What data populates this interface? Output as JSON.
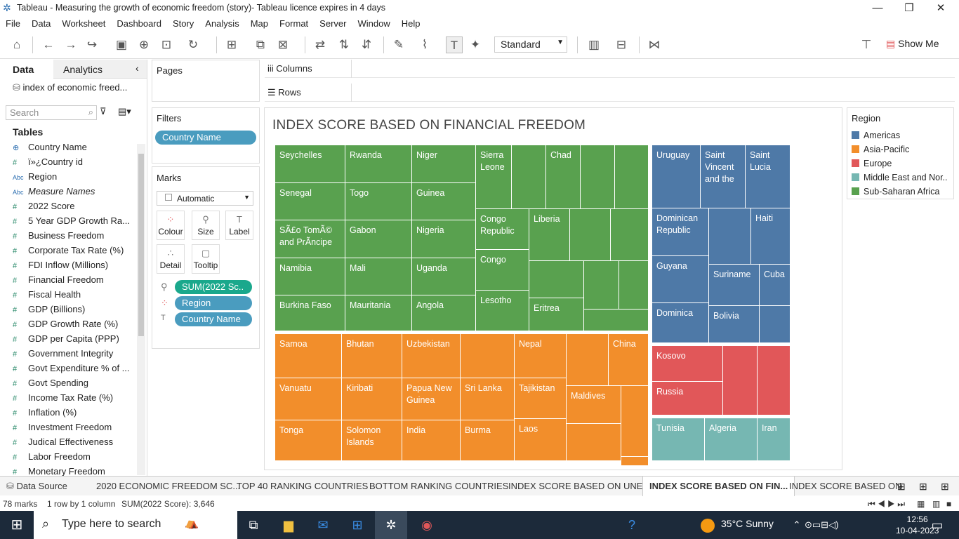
{
  "window": {
    "title": "Tableau - Measuring the growth of economic freedom (story)- Tableau licence expires in 4 days"
  },
  "menu": [
    "File",
    "Data",
    "Worksheet",
    "Dashboard",
    "Story",
    "Analysis",
    "Map",
    "Format",
    "Server",
    "Window",
    "Help"
  ],
  "toolbar": {
    "view_size": "Standard",
    "show_me": "Show Me"
  },
  "left_panel": {
    "tab_data": "Data",
    "tab_analytics": "Analytics",
    "data_source": "index of economic freed...",
    "search_placeholder": "Search",
    "tables_heading": "Tables",
    "fields": [
      {
        "type": "geo",
        "name": "Country Name"
      },
      {
        "type": "num",
        "name": "ï»¿Country id"
      },
      {
        "type": "abc",
        "name": "Region"
      },
      {
        "type": "abc",
        "name": "Measure Names"
      },
      {
        "type": "num",
        "name": "2022 Score"
      },
      {
        "type": "num",
        "name": "5 Year GDP Growth Ra..."
      },
      {
        "type": "num",
        "name": "Business Freedom"
      },
      {
        "type": "num",
        "name": "Corporate Tax Rate (%)"
      },
      {
        "type": "num",
        "name": "FDI Inflow (Millions)"
      },
      {
        "type": "num",
        "name": "Financial Freedom"
      },
      {
        "type": "num",
        "name": "Fiscal Health"
      },
      {
        "type": "num",
        "name": "GDP (Billions)"
      },
      {
        "type": "num",
        "name": "GDP Growth Rate (%)"
      },
      {
        "type": "num",
        "name": "GDP per Capita (PPP)"
      },
      {
        "type": "num",
        "name": "Government Integrity"
      },
      {
        "type": "num",
        "name": "Govt Expenditure % of ..."
      },
      {
        "type": "num",
        "name": "Govt Spending"
      },
      {
        "type": "num",
        "name": "Income Tax Rate (%)"
      },
      {
        "type": "num",
        "name": "Inflation (%)"
      },
      {
        "type": "num",
        "name": "Investment Freedom"
      },
      {
        "type": "num",
        "name": "Judical Effectiveness"
      },
      {
        "type": "num",
        "name": "Labor Freedom"
      },
      {
        "type": "num",
        "name": "Monetary Freedom"
      }
    ]
  },
  "cards": {
    "pages": "Pages",
    "filters": "Filters",
    "filter_pill": "Country Name",
    "marks": "Marks",
    "mark_type": "Automatic",
    "mark_buttons": [
      "Colour",
      "Size",
      "Label",
      "Detail",
      "Tooltip"
    ],
    "mark_pills": [
      "SUM(2022 Sc..",
      "Region",
      "Country Name"
    ]
  },
  "shelves": {
    "columns": "Columns",
    "rows": "Rows"
  },
  "view": {
    "title": "INDEX SCORE BASED ON FINANCIAL FREEDOM"
  },
  "legend": {
    "title": "Region",
    "items": [
      {
        "label": "Americas",
        "color": "#4e79a7"
      },
      {
        "label": "Asia-Pacific",
        "color": "#f28e2b"
      },
      {
        "label": "Europe",
        "color": "#e15759"
      },
      {
        "label": "Middle East and Nor..",
        "color": "#76b7b2"
      },
      {
        "label": "Sub-Saharan Africa",
        "color": "#59a14f"
      }
    ]
  },
  "treemap_labels": {
    "seychelles": "Seychelles",
    "rwanda": "Rwanda",
    "niger": "Niger",
    "sierra": "Sierra Leone",
    "chad": "Chad",
    "senegal": "Senegal",
    "togo": "Togo",
    "guinea": "Guinea",
    "congo_rep": "Congo Republic",
    "liberia": "Liberia",
    "sao": "SÃ£o TomÃ© and PrÃ­ncipe",
    "gabon": "Gabon",
    "nigeria": "Nigeria",
    "congo": "Congo",
    "namibia": "Namibia",
    "mali": "Mali",
    "uganda": "Uganda",
    "lesotho": "Lesotho",
    "eritrea": "Eritrea",
    "burkina": "Burkina Faso",
    "mauritania": "Mauritania",
    "angola": "Angola",
    "uruguay": "Uruguay",
    "svg": "Saint Vincent and the",
    "lucia": "Saint Lucia",
    "dominican": "Dominican Republic",
    "haiti": "Haiti",
    "guyana": "Guyana",
    "suriname": "Suriname",
    "cuba": "Cuba",
    "dominica": "Dominica",
    "bolivia": "Bolivia",
    "samoa": "Samoa",
    "bhutan": "Bhutan",
    "uzbekistan": "Uzbekistan",
    "nepal": "Nepal",
    "china": "China",
    "vanuatu": "Vanuatu",
    "kiribati": "Kiribati",
    "png": "Papua New Guinea",
    "srilanka": "Sri Lanka",
    "tajikistan": "Tajikistan",
    "maldives": "Maldives",
    "tonga": "Tonga",
    "solomon": "Solomon Islands",
    "india": "India",
    "burma": "Burma",
    "laos": "Laos",
    "kosovo": "Kosovo",
    "russia": "Russia",
    "tunisia": "Tunisia",
    "algeria": "Algeria",
    "iran": "Iran"
  },
  "sheet_tabs": {
    "datasource": "Data Source",
    "t1": "2020 ECONOMIC FREEDOM SC...",
    "t2": "TOP 40 RANKING COUNTRIES",
    "t3": "BOTTOM RANKING COUNTRIES",
    "t4": "INDEX SCORE BASED ON UNE...",
    "t5": "INDEX SCORE BASED ON FIN...",
    "t6": "INDEX SCORE BASED ON"
  },
  "status": {
    "marks": "78 marks",
    "dims": "1 row by 1 column",
    "sum": "SUM(2022 Score): 3,646"
  },
  "taskbar": {
    "search": "Type here to search",
    "weather": "35°C  Sunny",
    "time": "12:56",
    "date": "10-04-2023"
  }
}
